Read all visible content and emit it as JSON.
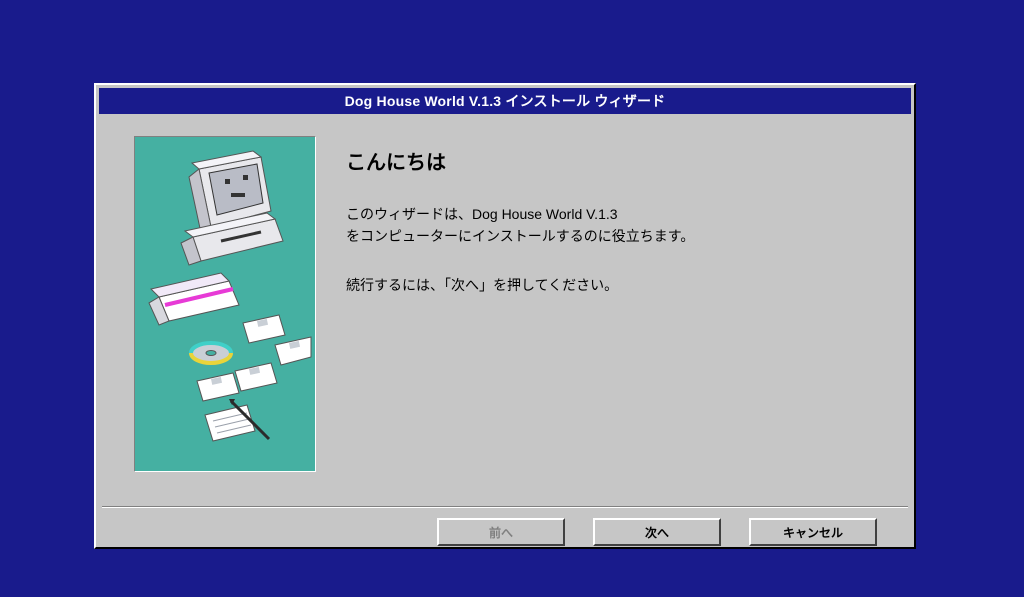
{
  "title": "Dog House World V.1.3 インストール ウィザード",
  "heading": "こんにちは",
  "body_line1": "このウィザードは、Dog House World V.1.3",
  "body_line2": "をコンピューターにインストールするのに役立ちます。",
  "body_line3": "続行するには、「次へ」を押してください。",
  "buttons": {
    "back": "前へ",
    "next": "次へ",
    "cancel": "キャンセル"
  },
  "colors": {
    "desktop_bg": "#191b8c",
    "window_bg": "#c6c6c6",
    "panel_bg": "#45b0a2"
  }
}
